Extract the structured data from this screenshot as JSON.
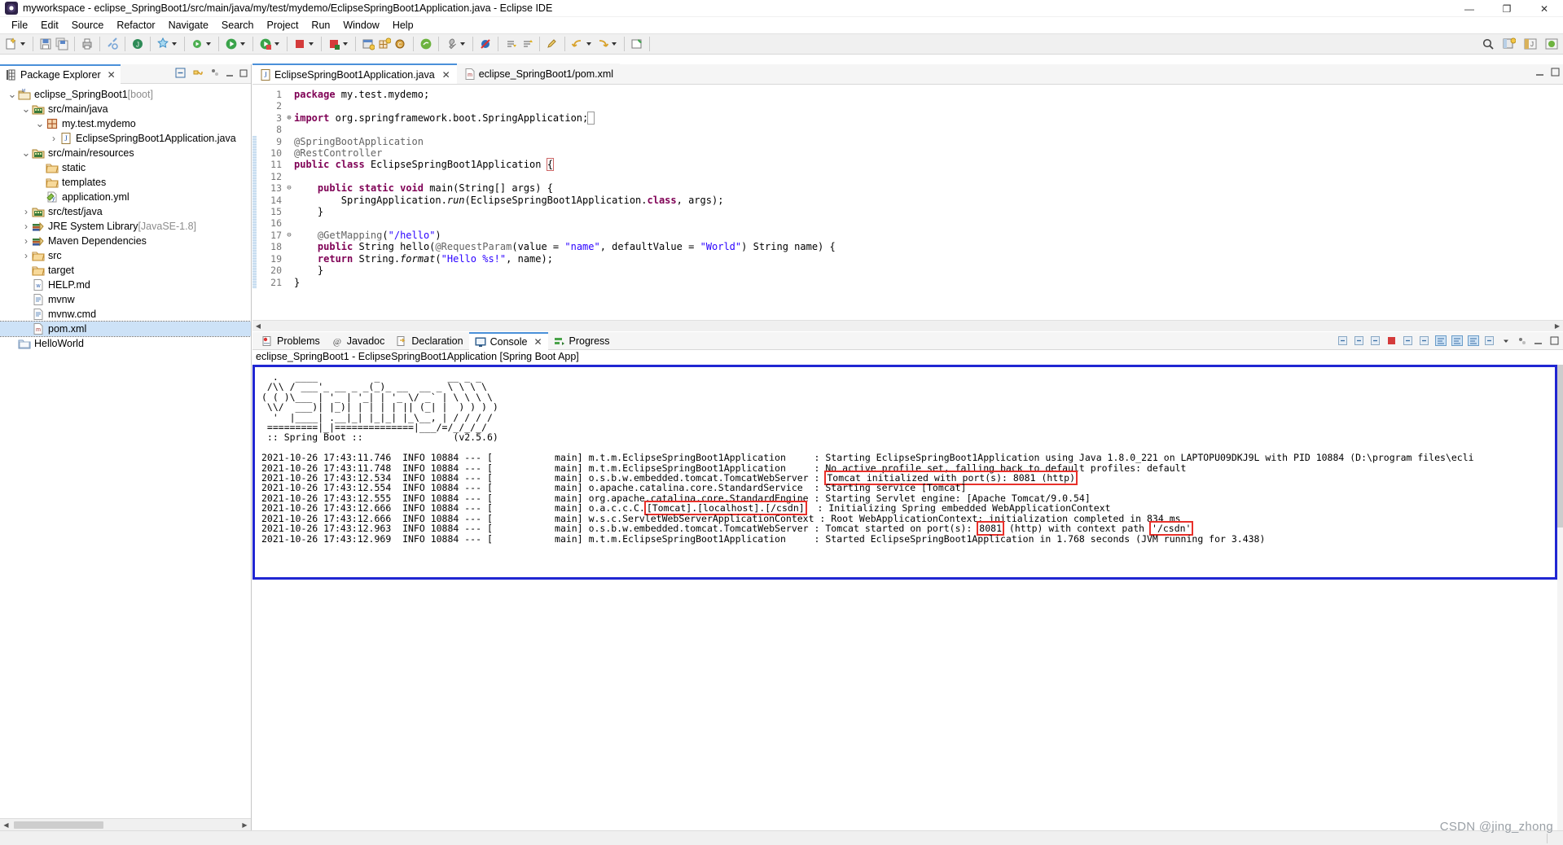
{
  "window": {
    "title": "myworkspace - eclipse_SpringBoot1/src/main/java/my/test/mydemo/EclipseSpringBoot1Application.java - Eclipse IDE",
    "app_icon": "eclipse-icon",
    "minimize": "—",
    "maximize": "❐",
    "close": "✕"
  },
  "menubar": {
    "items": [
      "File",
      "Edit",
      "Source",
      "Refactor",
      "Navigate",
      "Search",
      "Project",
      "Run",
      "Window",
      "Help"
    ]
  },
  "toolbar": {
    "groups": [
      {
        "icons": [
          "new-wizard-icon",
          "dropdown-arrow"
        ]
      },
      {
        "icons": [
          "save-icon",
          "save-all-icon"
        ]
      },
      {
        "icons": [
          "print-icon"
        ]
      },
      {
        "icons": [
          "link-icon"
        ]
      },
      {
        "icons": [
          "open-type-icon"
        ]
      },
      {
        "icons": [
          "build-icon",
          "dropdown-arrow"
        ]
      },
      {
        "icons": [
          "debug-icon",
          "dropdown-arrow"
        ]
      },
      {
        "icons": [
          "run-icon",
          "dropdown-arrow"
        ]
      },
      {
        "icons": [
          "run-coverage-icon",
          "dropdown-arrow"
        ]
      },
      {
        "icons": [
          "terminate-icon",
          "dropdown-arrow"
        ]
      },
      {
        "icons": [
          "stop-icon",
          "dropdown-arrow"
        ]
      },
      {
        "icons": [
          "new-java-project-icon",
          "new-package-icon",
          "new-class-icon"
        ]
      },
      {
        "icons": [
          "spring-boot-icon"
        ]
      },
      {
        "icons": [
          "external-tools-icon",
          "dropdown-arrow"
        ]
      },
      {
        "icons": [
          "skip-breakpoints-icon"
        ]
      },
      {
        "icons": [
          "next-annotation-icon",
          "previous-annotation-icon"
        ]
      },
      {
        "icons": [
          "last-edit-location-icon"
        ]
      },
      {
        "icons": [
          "back-icon",
          "dropdown-arrow",
          "forward-icon",
          "dropdown-arrow"
        ]
      },
      {
        "icons": [
          "pin-editor-icon"
        ]
      }
    ],
    "right_icons": [
      "search-icon",
      "open-perspective-icon",
      "java-perspective-icon",
      "spring-perspective-icon"
    ]
  },
  "package_explorer": {
    "tab_label": "Package Explorer",
    "tab_icon": "package-explorer-icon",
    "close_icon": "close-icon",
    "view_tools": [
      "collapse-all-icon",
      "link-with-editor-icon",
      "view-menu-icon",
      "minimize-icon",
      "maximize-icon"
    ],
    "tree": [
      {
        "label": "eclipse_SpringBoot1",
        "suffix": " [boot]",
        "indent": 0,
        "twisty": "⌄",
        "icon": "java-project-icon",
        "selected": false
      },
      {
        "label": "src/main/java",
        "suffix": "",
        "indent": 1,
        "twisty": "⌄",
        "icon": "source-folder-icon",
        "selected": false
      },
      {
        "label": "my.test.mydemo",
        "suffix": "",
        "indent": 2,
        "twisty": "⌄",
        "icon": "package-icon",
        "selected": false
      },
      {
        "label": "EclipseSpringBoot1Application.java",
        "suffix": "",
        "indent": 3,
        "twisty": "›",
        "icon": "java-file-icon",
        "selected": false
      },
      {
        "label": "src/main/resources",
        "suffix": "",
        "indent": 1,
        "twisty": "⌄",
        "icon": "source-folder-icon",
        "selected": false
      },
      {
        "label": "static",
        "suffix": "",
        "indent": 2,
        "twisty": "",
        "icon": "folder-icon",
        "selected": false
      },
      {
        "label": "templates",
        "suffix": "",
        "indent": 2,
        "twisty": "",
        "icon": "folder-icon",
        "selected": false
      },
      {
        "label": "application.yml",
        "suffix": "",
        "indent": 2,
        "twisty": "",
        "icon": "yaml-file-icon",
        "selected": false
      },
      {
        "label": "src/test/java",
        "suffix": "",
        "indent": 1,
        "twisty": "›",
        "icon": "source-folder-icon",
        "selected": false
      },
      {
        "label": "JRE System Library",
        "suffix": " [JavaSE-1.8]",
        "indent": 1,
        "twisty": "›",
        "icon": "library-icon",
        "selected": false
      },
      {
        "label": "Maven Dependencies",
        "suffix": "",
        "indent": 1,
        "twisty": "›",
        "icon": "library-icon",
        "selected": false
      },
      {
        "label": "src",
        "suffix": "",
        "indent": 1,
        "twisty": "›",
        "icon": "folder-icon",
        "selected": false
      },
      {
        "label": "target",
        "suffix": "",
        "indent": 1,
        "twisty": "",
        "icon": "folder-icon",
        "selected": false
      },
      {
        "label": "HELP.md",
        "suffix": "",
        "indent": 1,
        "twisty": "",
        "icon": "markdown-file-icon",
        "selected": false
      },
      {
        "label": "mvnw",
        "suffix": "",
        "indent": 1,
        "twisty": "",
        "icon": "file-icon",
        "selected": false
      },
      {
        "label": "mvnw.cmd",
        "suffix": "",
        "indent": 1,
        "twisty": "",
        "icon": "file-icon",
        "selected": false
      },
      {
        "label": "pom.xml",
        "suffix": "",
        "indent": 1,
        "twisty": "",
        "icon": "maven-pom-icon",
        "selected": true
      },
      {
        "label": "HelloWorld",
        "suffix": "",
        "indent": 0,
        "twisty": "",
        "icon": "project-icon",
        "selected": false
      }
    ]
  },
  "editor": {
    "tabs": [
      {
        "label": "EclipseSpringBoot1Application.java",
        "icon": "java-file-icon",
        "active": true,
        "closable": true
      },
      {
        "label": "eclipse_SpringBoot1/pom.xml",
        "icon": "maven-pom-icon",
        "active": false,
        "closable": false
      }
    ],
    "tools": [
      "minimize-icon",
      "maximize-icon"
    ],
    "lines": [
      {
        "num": "1",
        "fold": "",
        "html": "<span class=\"kw\">package</span> my.test.mydemo;"
      },
      {
        "num": "2",
        "fold": "",
        "html": ""
      },
      {
        "num": "3",
        "fold": "⊕",
        "html": "<span class=\"kw\">import</span> org.springframework.boot.SpringApplication;<span style=\"outline:1px solid #999;color:#999\"> </span>"
      },
      {
        "num": "8",
        "fold": "",
        "html": ""
      },
      {
        "num": "9",
        "fold": "",
        "html": "<span class=\"ann\">@SpringBootApplication</span>"
      },
      {
        "num": "10",
        "fold": "",
        "html": "<span class=\"ann\">@RestController</span>"
      },
      {
        "num": "11",
        "fold": "",
        "html": "<span class=\"kw\">public</span> <span class=\"kw\">class</span> EclipseSpringBoot1Application <span style=\"outline:1px solid #c66;\">{</span>"
      },
      {
        "num": "12",
        "fold": "",
        "html": ""
      },
      {
        "num": "13",
        "fold": "⊖",
        "html": "    <span class=\"kw\">public</span> <span class=\"kw\">static</span> <span class=\"kw\">void</span> main(String[] args) {"
      },
      {
        "num": "14",
        "fold": "",
        "html": "        SpringApplication.<span class=\"it\">run</span>(EclipseSpringBoot1Application.<span class=\"kw\">class</span>, args);"
      },
      {
        "num": "15",
        "fold": "",
        "html": "    }"
      },
      {
        "num": "16",
        "fold": "",
        "html": ""
      },
      {
        "num": "17",
        "fold": "⊖",
        "html": "    <span class=\"ann\">@GetMapping</span>(<span class=\"str\">\"/hello\"</span>)"
      },
      {
        "num": "18",
        "fold": "",
        "html": "    <span class=\"kw\">public</span> String hello(<span class=\"ann\">@RequestParam</span>(value = <span class=\"str\">\"name\"</span>, defaultValue = <span class=\"str\">\"World\"</span>) String name) {"
      },
      {
        "num": "19",
        "fold": "",
        "html": "    <span class=\"kw\">return</span> String.<span class=\"it\">format</span>(<span class=\"str\">\"Hello %s!\"</span>, name);"
      },
      {
        "num": "20",
        "fold": "",
        "html": "    }"
      },
      {
        "num": "21",
        "fold": "",
        "html": "}"
      }
    ]
  },
  "console": {
    "tabs": [
      {
        "label": "Problems",
        "icon": "problems-icon",
        "active": false,
        "closable": false
      },
      {
        "label": "Javadoc",
        "icon": "javadoc-icon",
        "active": false,
        "closable": false
      },
      {
        "label": "Declaration",
        "icon": "declaration-icon",
        "active": false,
        "closable": false
      },
      {
        "label": "Console",
        "icon": "console-icon",
        "active": true,
        "closable": true
      },
      {
        "label": "Progress",
        "icon": "progress-icon",
        "active": false,
        "closable": false
      }
    ],
    "tools": [
      "pin-console-icon",
      "remove-launch-icon",
      "remove-all-launches-icon",
      "terminate-icon",
      "display-selected-console-icon",
      "open-console-icon",
      "word-wrap-icon",
      "scroll-lock-icon",
      "show-console-on-output-icon",
      "new-console-view-icon",
      "dropdown-arrow",
      "view-menu-icon",
      "minimize-icon",
      "maximize-icon"
    ],
    "header": "eclipse_SpringBoot1 - EclipseSpringBoot1Application [Spring Boot App]",
    "banner": [
      "  .   ____          _            __ _ _",
      " /\\\\ / ___'_ __ _ _(_)_ __  __ _ \\ \\ \\ \\",
      "( ( )\\___ | '_ | '_| | '_ \\/ _` | \\ \\ \\ \\",
      " \\\\/  ___)| |_)| | | | | || (_| |  ) ) ) )",
      "  '  |____| .__|_| |_|_| |_\\__, | / / / /",
      " =========|_|==============|___/=/_/_/_/",
      " :: Spring Boot ::                (v2.5.6)"
    ],
    "log_lines": [
      {
        "ts": "2021-10-26 17:43:11.746",
        "level": "INFO",
        "pid": "10884",
        "thread": "main",
        "logger": "m.t.m.EclipseSpringBoot1Application",
        "msg": "Starting EclipseSpringBoot1Application using Java 1.8.0_221 on LAPTOPU09DKJ9L with PID 10884 (D:\\program files\\ecli",
        "highlight": null
      },
      {
        "ts": "2021-10-26 17:43:11.748",
        "level": "INFO",
        "pid": "10884",
        "thread": "main",
        "logger": "m.t.m.EclipseSpringBoot1Application",
        "msg": "No active profile set, falling back to default profiles: default",
        "highlight": null
      },
      {
        "ts": "2021-10-26 17:43:12.534",
        "level": "INFO",
        "pid": "10884",
        "thread": "main",
        "logger": "o.s.b.w.embedded.tomcat.TomcatWebServer",
        "msg": "Tomcat initialized with port(s): 8081 (http)",
        "highlight": "msg-full"
      },
      {
        "ts": "2021-10-26 17:43:12.554",
        "level": "INFO",
        "pid": "10884",
        "thread": "main",
        "logger": "o.apache.catalina.core.StandardService",
        "msg": "Starting service [Tomcat]",
        "highlight": null
      },
      {
        "ts": "2021-10-26 17:43:12.555",
        "level": "INFO",
        "pid": "10884",
        "thread": "main",
        "logger": "org.apache.catalina.core.StandardEngine",
        "msg": "Starting Servlet engine: [Apache Tomcat/9.0.54]",
        "highlight": null
      },
      {
        "ts": "2021-10-26 17:43:12.666",
        "level": "INFO",
        "pid": "10884",
        "thread": "main",
        "logger": "o.a.c.c.C.[Tomcat].[localhost].[/csdn]",
        "msg": "Initializing Spring embedded WebApplicationContext",
        "highlight": "logger-part"
      },
      {
        "ts": "2021-10-26 17:43:12.666",
        "level": "INFO",
        "pid": "10884",
        "thread": "main",
        "logger": "w.s.c.ServletWebServerApplicationContext",
        "msg": "Root WebApplicationContext: initialization completed in 834 ms",
        "highlight": null
      },
      {
        "ts": "2021-10-26 17:43:12.963",
        "level": "INFO",
        "pid": "10884",
        "thread": "main",
        "logger": "o.s.b.w.embedded.tomcat.TomcatWebServer",
        "msg": "Tomcat started on port(s): 8081 (http) with context path '/csdn'",
        "highlight": "port-and-path"
      },
      {
        "ts": "2021-10-26 17:43:12.969",
        "level": "INFO",
        "pid": "10884",
        "thread": "main",
        "logger": "m.t.m.EclipseSpringBoot1Application",
        "msg": "Started EclipseSpringBoot1Application in 1.768 seconds (JVM running for 3.438)",
        "highlight": null
      }
    ],
    "highlights": {
      "tomcat_port_line": "Tomcat initialized with port(s): 8081 (http)",
      "logger_context": "[Tomcat].[localhost].[/csdn]",
      "started_port": "8081",
      "context_path": "'/csdn'"
    },
    "box_color": "#2026d2",
    "highlight_color": "#e8302a"
  },
  "watermark": "CSDN @jing_zhong",
  "colors": {
    "accent": "#4a90d9",
    "console_box": "#2026d2",
    "highlight": "#e8302a",
    "keyword": "#7f0055",
    "string": "#2a00ff",
    "annotation": "#646464"
  }
}
